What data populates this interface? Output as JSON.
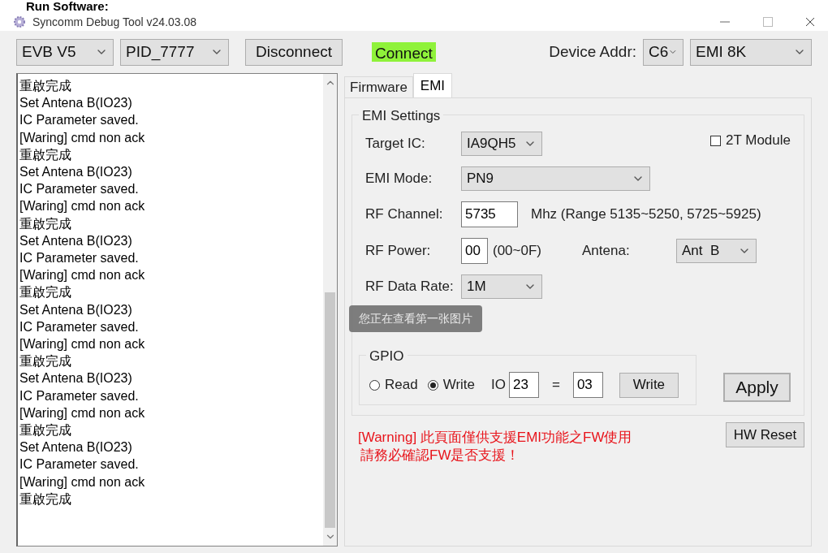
{
  "heading": "Run Software:",
  "window": {
    "title": "Syncomm Debug Tool v24.03.08"
  },
  "toolbar": {
    "board": "EVB V5",
    "pid": "PID_7777",
    "disconnect": "Disconnect",
    "connect": "Connect",
    "device_addr_label": "Device Addr:",
    "device_addr": "C6",
    "mode": "EMI 8K"
  },
  "log": [
    "重啟完成",
    "Set Antena B(IO23)",
    "IC Parameter saved.",
    "[Waring] cmd non ack",
    "重啟完成",
    "Set Antena B(IO23)",
    "IC Parameter saved.",
    "[Waring] cmd non ack",
    "重啟完成",
    "Set Antena B(IO23)",
    "IC Parameter saved.",
    "[Waring] cmd non ack",
    "重啟完成",
    "Set Antena B(IO23)",
    "IC Parameter saved.",
    "[Waring] cmd non ack",
    "重啟完成",
    "Set Antena B(IO23)",
    "IC Parameter saved.",
    "[Waring] cmd non ack",
    "重啟完成",
    "Set Antena B(IO23)",
    "IC Parameter saved.",
    "[Waring] cmd non ack",
    "重啟完成"
  ],
  "tabs": [
    {
      "label": "Firmware",
      "selected": false
    },
    {
      "label": "EMI",
      "selected": true
    }
  ],
  "emi_settings": {
    "title": "EMI Settings",
    "target_ic_label": "Target IC:",
    "target_ic": "IA9QH5",
    "module_2t": {
      "label": "2T Module",
      "checked": false
    },
    "emi_mode_label": "EMI Mode:",
    "emi_mode": "PN9",
    "rf_channel_label": "RF Channel:",
    "rf_channel": "5735",
    "rf_channel_hint": "Mhz (Range 5135~5250, 5725~5925)",
    "rf_power_label": "RF Power:",
    "rf_power": "00",
    "rf_power_hint": "(00~0F)",
    "antena_label": "Antena:",
    "antena": "Ant  B",
    "data_rate_label": "RF Data Rate:",
    "data_rate": "1M"
  },
  "gpio": {
    "title": "GPIO",
    "modes": [
      {
        "label": "Read",
        "selected": false
      },
      {
        "label": "Write",
        "selected": true
      }
    ],
    "io_label": "IO",
    "io": "23",
    "equals": "=",
    "value": "03",
    "write_button": "Write"
  },
  "apply": "Apply",
  "warning": [
    "[Warning] 此頁面僅供支援EMI功能之FW使用",
    "請務必確認FW是否支援！"
  ],
  "hw_reset": "HW Reset",
  "toast": "您正在查看第一张图片"
}
